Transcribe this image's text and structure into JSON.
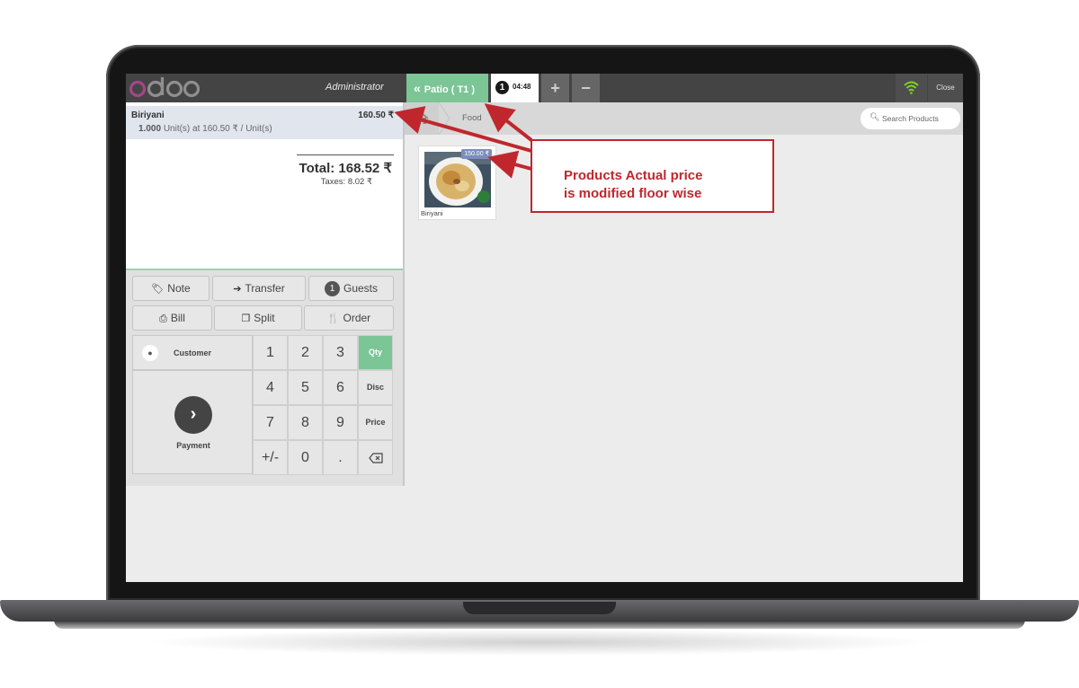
{
  "app": {
    "logo": "odoo",
    "user": "Administrator"
  },
  "topbar": {
    "floor_button": "Patio ( T1 )",
    "order_number": "1",
    "order_time": "04:48",
    "add_order": "+",
    "remove_order": "−",
    "close": "Close"
  },
  "orderline": {
    "name": "Biriyani",
    "price": "160.50 ₹",
    "qty": "1.000",
    "info": "Unit(s) at 160.50 ₹ / Unit(s)"
  },
  "summary": {
    "total": "Total: 168.52 ₹",
    "taxes": "Taxes: 8.02 ₹"
  },
  "controls": {
    "note": "Note",
    "transfer": "Transfer",
    "guests_count": "1",
    "guests": "Guests",
    "bill": "Bill",
    "split": "Split",
    "order": "Order"
  },
  "numpad": {
    "customer": "Customer",
    "payment": "Payment",
    "keys": [
      "1",
      "2",
      "3",
      "4",
      "5",
      "6",
      "7",
      "8",
      "9",
      "+/-",
      "0",
      "."
    ],
    "modes": [
      "Qty",
      "Disc",
      "Price"
    ],
    "active_mode": "Qty"
  },
  "products_screen": {
    "breadcrumb": "Food",
    "search_placeholder": "Search Products",
    "products": [
      {
        "name": "Biriyani",
        "price": "150.00 ₹"
      }
    ]
  },
  "annotation": {
    "line1": "Products Actual price",
    "line2": "is modified floor wise"
  },
  "colors": {
    "accent_green": "#7bc596",
    "odoo_purple": "#a24689",
    "annotation_red": "#c0272d",
    "price_tag": "#7d8dbc"
  }
}
